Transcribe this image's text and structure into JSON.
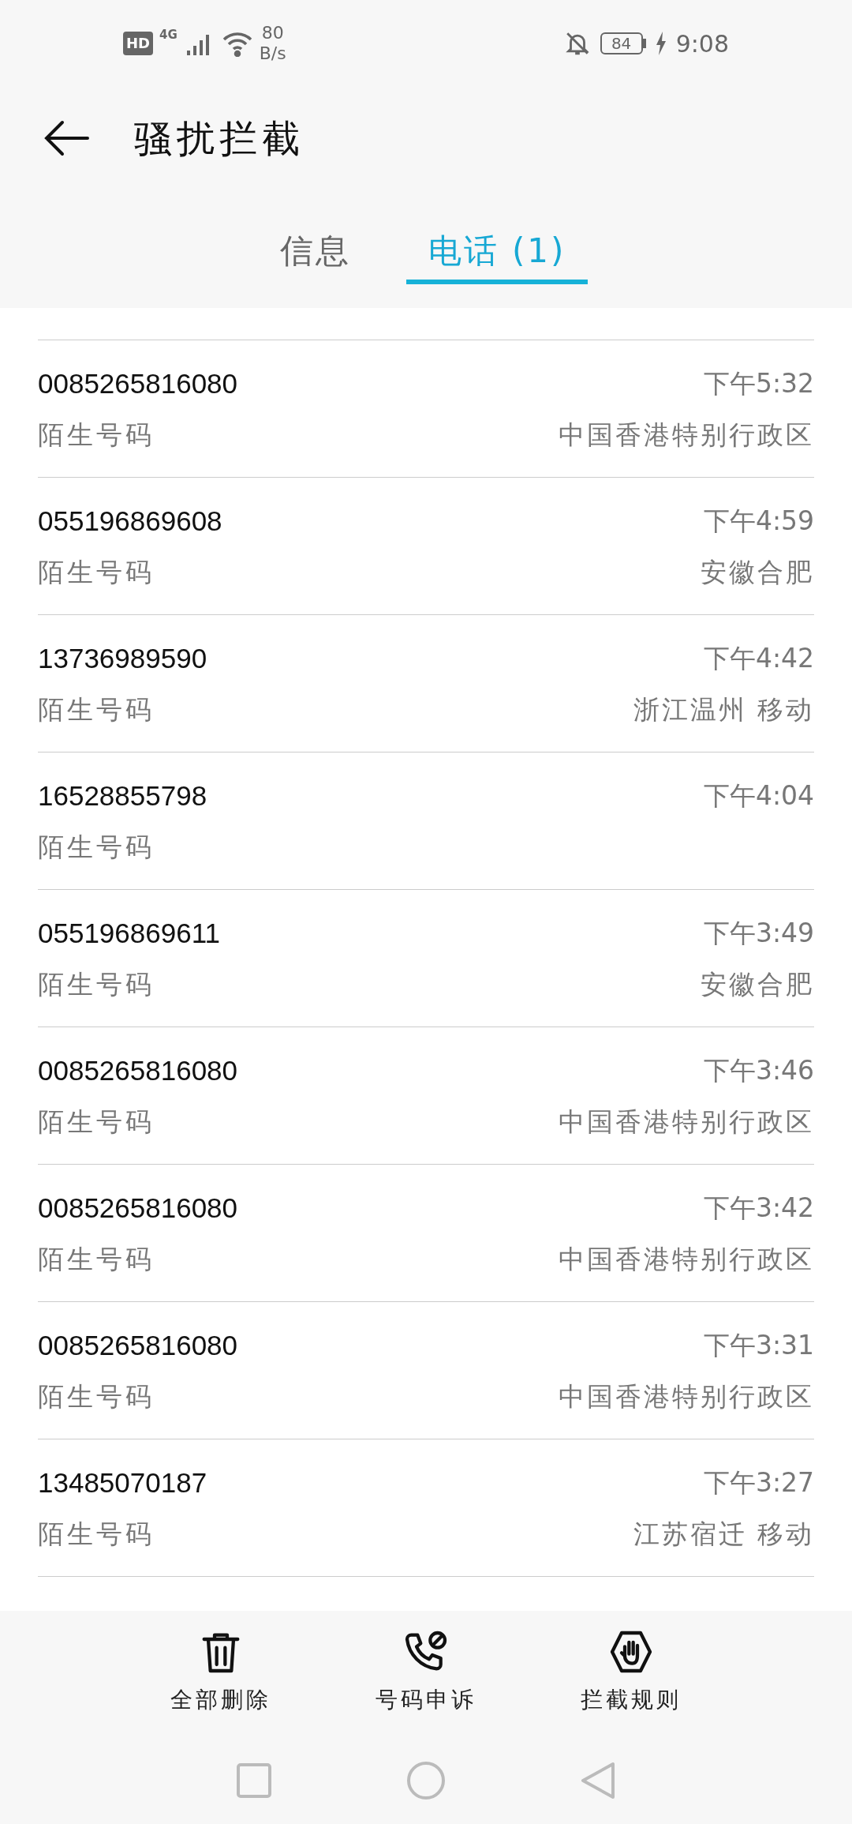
{
  "status_bar": {
    "hd": "HD",
    "network_type": "4G",
    "network_speed": "80",
    "network_speed_unit": "B/s",
    "battery": "84",
    "time": "9:08"
  },
  "header": {
    "title": "骚扰拦截"
  },
  "tabs": [
    {
      "label": "信息",
      "selected": false
    },
    {
      "label": "电话 (1)",
      "selected": true
    }
  ],
  "calls": [
    {
      "number": "0085265816080",
      "type": "陌生号码",
      "time": "下午5:32",
      "location": "中国香港特别行政区"
    },
    {
      "number": "055196869608",
      "type": "陌生号码",
      "time": "下午4:59",
      "location": "安徽合肥"
    },
    {
      "number": "13736989590",
      "type": "陌生号码",
      "time": "下午4:42",
      "location": "浙江温州 移动"
    },
    {
      "number": "16528855798",
      "type": "陌生号码",
      "time": "下午4:04"
    },
    {
      "number": "055196869611",
      "type": "陌生号码",
      "time": "下午3:49",
      "location": "安徽合肥"
    },
    {
      "number": "0085265816080",
      "type": "陌生号码",
      "time": "下午3:46",
      "location": "中国香港特别行政区"
    },
    {
      "number": "0085265816080",
      "type": "陌生号码",
      "time": "下午3:42",
      "location": "中国香港特别行政区"
    },
    {
      "number": "0085265816080",
      "type": "陌生号码",
      "time": "下午3:31",
      "location": "中国香港特别行政区"
    },
    {
      "number": "13485070187",
      "type": "陌生号码",
      "time": "下午3:27",
      "location": "江苏宿迁 移动"
    }
  ],
  "toolbar": [
    {
      "kind": "delete",
      "label": "全部删除"
    },
    {
      "kind": "appeal",
      "label": "号码申诉"
    },
    {
      "kind": "rules",
      "label": "拦截规则"
    }
  ]
}
